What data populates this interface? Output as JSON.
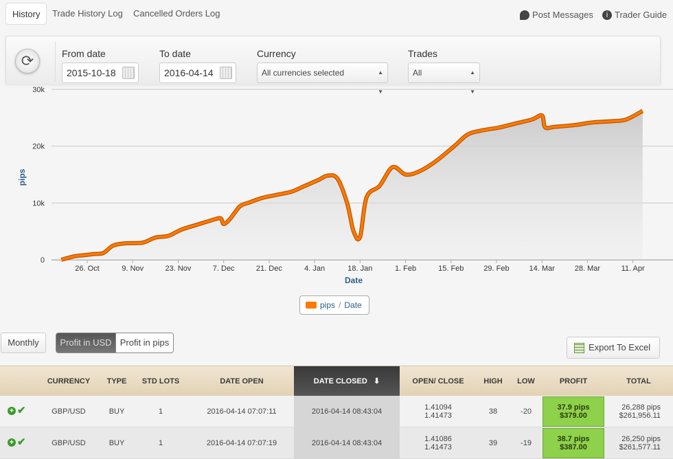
{
  "tabs": [
    {
      "label": "History",
      "active": true
    },
    {
      "label": "Trade History Log",
      "active": false
    },
    {
      "label": "Cancelled Orders Log",
      "active": false
    }
  ],
  "top_links": {
    "post_messages": "Post Messages",
    "trader_guide": "Trader Guide"
  },
  "filters": {
    "refresh_icon": "refresh-icon",
    "from_label": "From date",
    "from_value": "2015-10-18",
    "to_label": "To date",
    "to_value": "2016-04-14",
    "currency_label": "Currency",
    "currency_value": "All currencies selected",
    "trades_label": "Trades",
    "trades_value": "All"
  },
  "chart_data": {
    "type": "area",
    "xlabel": "Date",
    "ylabel": "pips",
    "ylim": [
      0,
      30000
    ],
    "y_ticks": [
      "0",
      "10k",
      "20k",
      "30k"
    ],
    "x_ticks": [
      "26. Oct",
      "9. Nov",
      "23. Nov",
      "7. Dec",
      "21. Dec",
      "4. Jan",
      "18. Jan",
      "1. Feb",
      "15. Feb",
      "29. Feb",
      "14. Mar",
      "28. Mar",
      "11. Apr"
    ],
    "grid": true,
    "legend_position": "bottom-center",
    "color": "#ff7a00",
    "series": [
      {
        "name": "pips",
        "x": [
          "2015-10-18",
          "2015-10-22",
          "2015-10-25",
          "2015-10-28",
          "2015-10-31",
          "2015-11-03",
          "2015-11-07",
          "2015-11-12",
          "2015-11-16",
          "2015-11-20",
          "2015-11-24",
          "2015-11-29",
          "2015-12-03",
          "2015-12-06",
          "2015-12-07",
          "2015-12-09",
          "2015-12-12",
          "2015-12-15",
          "2015-12-19",
          "2015-12-24",
          "2015-12-28",
          "2016-01-01",
          "2016-01-05",
          "2016-01-08",
          "2016-01-11",
          "2016-01-14",
          "2016-01-16",
          "2016-01-18",
          "2016-01-20",
          "2016-01-24",
          "2016-01-28",
          "2016-02-01",
          "2016-02-05",
          "2016-02-10",
          "2016-02-16",
          "2016-02-20",
          "2016-02-24",
          "2016-03-01",
          "2016-03-06",
          "2016-03-11",
          "2016-03-14",
          "2016-03-15",
          "2016-03-18",
          "2016-03-24",
          "2016-03-30",
          "2016-04-05",
          "2016-04-09",
          "2016-04-14"
        ],
        "values": [
          0,
          600,
          800,
          1000,
          1200,
          2500,
          2900,
          3000,
          3900,
          4200,
          5300,
          6200,
          6900,
          7300,
          6300,
          7200,
          9400,
          10100,
          10900,
          11500,
          12000,
          13000,
          14000,
          14800,
          14300,
          10000,
          5000,
          4000,
          11000,
          13000,
          16300,
          15000,
          15500,
          17200,
          20000,
          22000,
          22700,
          23300,
          24000,
          24700,
          25400,
          23300,
          23400,
          23700,
          24200,
          24400,
          24700,
          26200
        ]
      }
    ]
  },
  "legend": {
    "series": "pips",
    "separator": "/",
    "axis": "Date"
  },
  "controls": {
    "monthly": "Monthly",
    "profit_usd": "Profit in USD",
    "profit_pips": "Profit in pips",
    "export": "Export To Excel"
  },
  "table": {
    "headers": {
      "currency": "CURRENCY",
      "type": "TYPE",
      "lots": "STD LOTS",
      "open": "DATE OPEN",
      "closed": "DATE CLOSED",
      "openclose": "OPEN/ CLOSE",
      "high": "HIGH",
      "low": "LOW",
      "profit": "PROFIT",
      "total": "TOTAL"
    },
    "rows": [
      {
        "currency": "GBP/USD",
        "type": "BUY",
        "lots": "1",
        "open": "2016-04-14 07:07:11",
        "closed": "2016-04-14 08:43:04",
        "open_price": "1.41094",
        "close_price": "1.41473",
        "high": "38",
        "low": "-20",
        "profit_pips": "37.9 pips",
        "profit_usd": "$379.00",
        "total_pips": "26,288 pips",
        "total_usd": "$261,956.11"
      },
      {
        "currency": "GBP/USD",
        "type": "BUY",
        "lots": "1",
        "open": "2016-04-14 07:07:19",
        "closed": "2016-04-14 08:43:04",
        "open_price": "1.41086",
        "close_price": "1.41473",
        "high": "39",
        "low": "-19",
        "profit_pips": "38.7 pips",
        "profit_usd": "$387.00",
        "total_pips": "26,250 pips",
        "total_usd": "$261,577.11"
      }
    ]
  }
}
